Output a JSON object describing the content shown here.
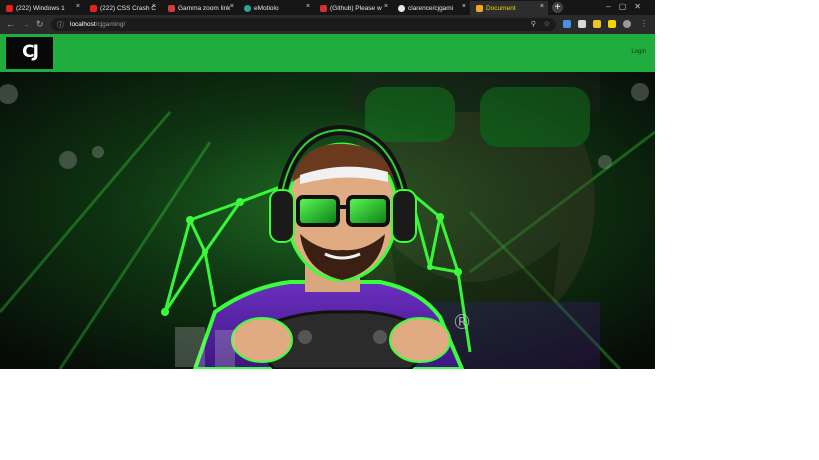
{
  "browser": {
    "tabs": [
      {
        "label": "(222) Windows 1",
        "icon": "youtube-icon",
        "color": "#e62117",
        "active": false
      },
      {
        "label": "(222) CSS Crash C",
        "icon": "youtube-icon",
        "color": "#e62117",
        "active": false
      },
      {
        "label": "Gamma zoom link",
        "icon": "gamma-icon",
        "color": "#d23c3c",
        "active": false
      },
      {
        "label": "eMotiolo",
        "icon": "site-icon",
        "color": "#2aa59a",
        "active": false
      },
      {
        "label": "(Github) Please w",
        "icon": "gmail-icon",
        "color": "#d93025",
        "active": false
      },
      {
        "label": "clarence/cjgami",
        "icon": "github-icon",
        "color": "#e8e8e8",
        "active": false
      },
      {
        "label": "Document",
        "icon": "document-icon",
        "color": "#f4a522",
        "active": true
      }
    ],
    "url_host": "localhost",
    "url_path": "/cjgaming/"
  },
  "site": {
    "logo_text": "CJ",
    "login_label": "Login"
  },
  "colors": {
    "accent_green": "#20ac3e",
    "neon_green": "#39ff3a",
    "purple": "#5a22a8",
    "background": "#0d0d0d"
  },
  "hero": {
    "image": "gamer-mascot-illustration",
    "registered_mark": "®"
  }
}
